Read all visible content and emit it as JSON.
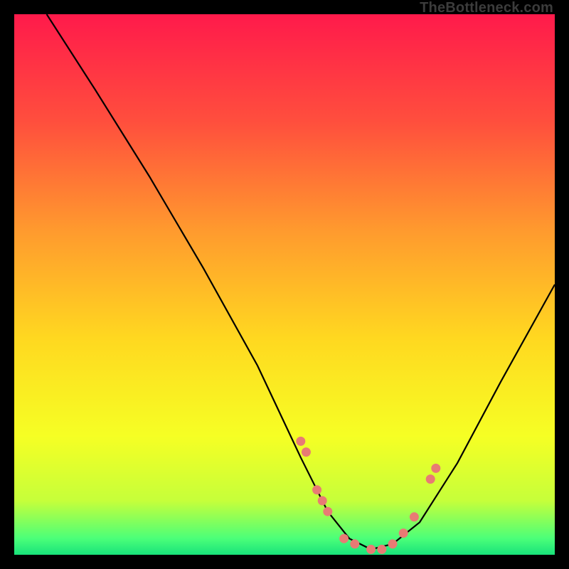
{
  "watermark": "TheBottleneck.com",
  "chart_data": {
    "type": "line",
    "title": "",
    "xlabel": "",
    "ylabel": "",
    "xlim": [
      0,
      100
    ],
    "ylim": [
      0,
      100
    ],
    "grid": false,
    "legend": false,
    "background_gradient": {
      "stops": [
        {
          "offset": 0.0,
          "color": "#ff1a4b"
        },
        {
          "offset": 0.2,
          "color": "#ff4f3d"
        },
        {
          "offset": 0.4,
          "color": "#ff9a2e"
        },
        {
          "offset": 0.6,
          "color": "#ffd820"
        },
        {
          "offset": 0.78,
          "color": "#f6ff24"
        },
        {
          "offset": 0.9,
          "color": "#c6ff3a"
        },
        {
          "offset": 0.97,
          "color": "#4bff79"
        },
        {
          "offset": 1.0,
          "color": "#18e27a"
        }
      ]
    },
    "series": [
      {
        "name": "bottleneck-curve",
        "type": "line",
        "color": "#000000",
        "x": [
          6,
          15,
          25,
          35,
          45,
          53,
          58,
          62,
          66,
          70,
          75,
          82,
          90,
          100
        ],
        "y": [
          100,
          86,
          70,
          53,
          35,
          18,
          8,
          3,
          1,
          2,
          6,
          17,
          32,
          50
        ]
      },
      {
        "name": "sample-points",
        "type": "scatter",
        "color": "#e87b74",
        "x": [
          53,
          54,
          56,
          57,
          58,
          61,
          63,
          66,
          68,
          70,
          72,
          74,
          77,
          78
        ],
        "y": [
          21,
          19,
          12,
          10,
          8,
          3,
          2,
          1,
          1,
          2,
          4,
          7,
          14,
          16
        ]
      }
    ]
  }
}
